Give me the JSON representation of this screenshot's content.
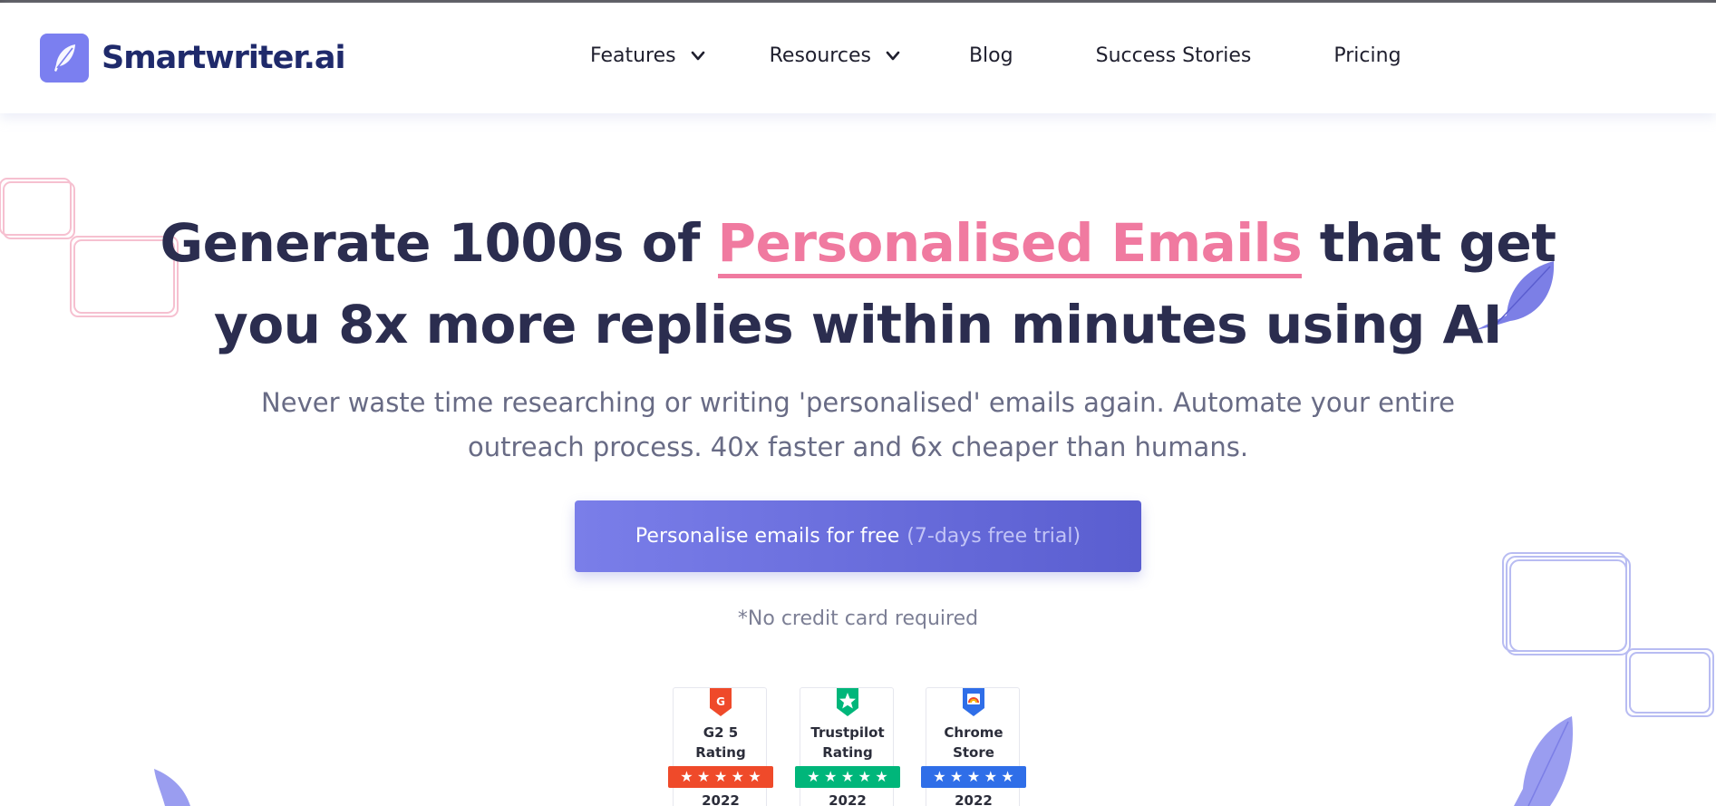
{
  "brand": {
    "name": "Smartwriter.ai",
    "logo_icon": "feather-icon",
    "accent": "#7b7ff0"
  },
  "nav": {
    "items": [
      {
        "label": "Features",
        "has_dropdown": true
      },
      {
        "label": "Resources",
        "has_dropdown": true
      },
      {
        "label": "Blog",
        "has_dropdown": false
      },
      {
        "label": "Success Stories",
        "has_dropdown": false
      },
      {
        "label": "Pricing",
        "has_dropdown": false
      }
    ]
  },
  "hero": {
    "title_before": "Generate 1000s of ",
    "title_highlight": "Personalised Emails",
    "title_after": " that get",
    "title_line2": "you 8x more replies within minutes using AI",
    "highlight_color": "#f07aa0",
    "subtitle": "Never waste time researching or writing 'personalised' emails again. Automate your entire outreach process. 40x faster and 6x cheaper than humans.",
    "cta_label": "Personalise emails for free",
    "cta_trial": "(7-days free trial)",
    "note": "*No credit card required"
  },
  "badges": [
    {
      "label_line1": "G2 5",
      "label_line2": "Rating",
      "year": "2022",
      "icon": "g2-icon",
      "color": "#ef4a2a"
    },
    {
      "label_line1": "Trustpilot",
      "label_line2": "Rating",
      "year": "2022",
      "icon": "trustpilot-star-icon",
      "color": "#00b67a"
    },
    {
      "label_line1": "Chrome",
      "label_line2": "Store",
      "year": "2022",
      "icon": "chrome-store-icon",
      "color": "#2f6ee8"
    }
  ]
}
